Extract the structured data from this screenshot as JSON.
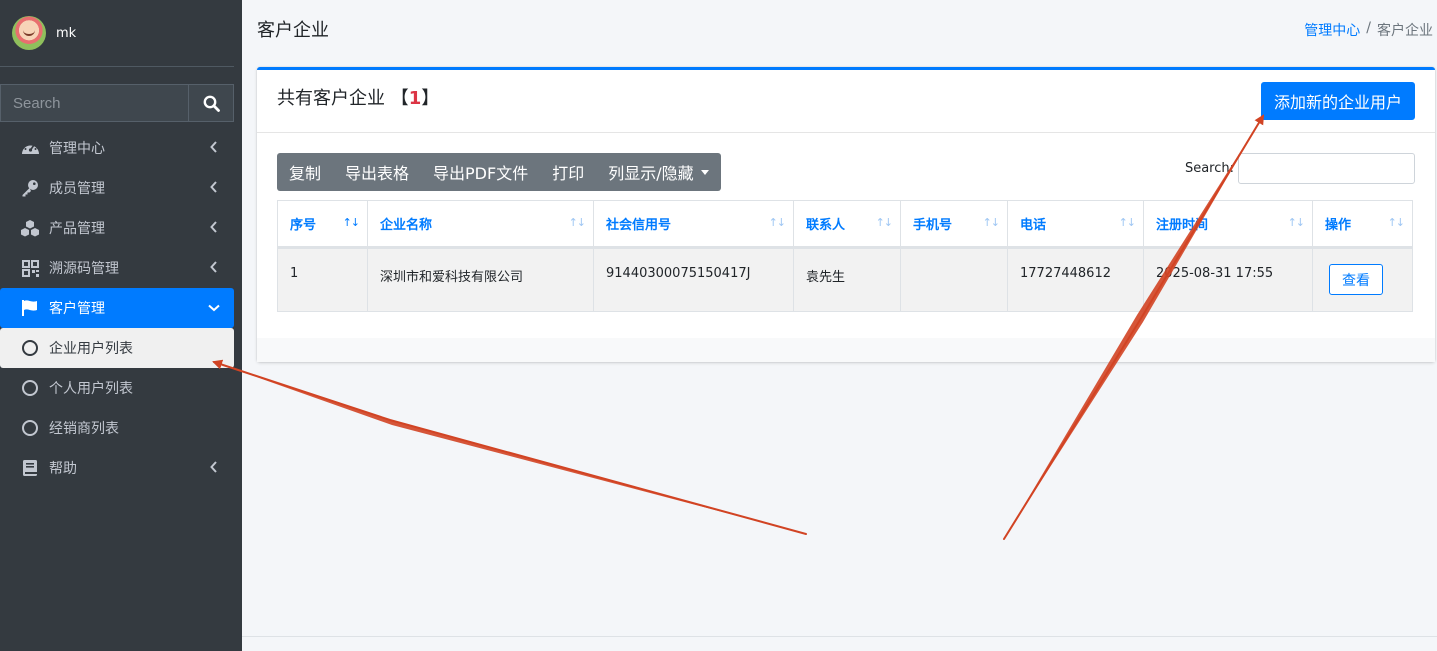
{
  "user": {
    "name": "mk"
  },
  "sidebar": {
    "search_placeholder": "Search",
    "items": [
      {
        "label": "管理中心",
        "icon": "dashboard-icon"
      },
      {
        "label": "成员管理",
        "icon": "key-icon"
      },
      {
        "label": "产品管理",
        "icon": "cubes-icon"
      },
      {
        "label": "溯源码管理",
        "icon": "qrcode-icon"
      },
      {
        "label": "客户管理",
        "icon": "flag-icon"
      }
    ],
    "subitems": [
      {
        "label": "企业用户列表"
      },
      {
        "label": "个人用户列表"
      },
      {
        "label": "经销商列表"
      }
    ],
    "help": {
      "label": "帮助",
      "icon": "book-icon"
    }
  },
  "header": {
    "title": "客户企业",
    "breadcrumb": {
      "home": "管理中心",
      "separator": "/",
      "current": "客户企业"
    }
  },
  "card": {
    "title_prefix": "共有客户企业 【",
    "count": "1",
    "title_suffix": "】",
    "add_button": "添加新的企业用户",
    "toolbar": [
      "复制",
      "导出表格",
      "导出PDF文件",
      "打印",
      "列显示/隐藏"
    ],
    "search_label": "Search:",
    "sort_icon": "↑↓"
  },
  "table": {
    "columns": [
      "序号",
      "企业名称",
      "社会信用号",
      "联系人",
      "手机号",
      "电话",
      "注册时间",
      "操作"
    ],
    "rows": [
      {
        "no": "1",
        "name": "深圳市和爱科技有限公司",
        "credit": "91440300075150417J",
        "contact": "袁先生",
        "mobile": "",
        "phone": "17727448612",
        "time": "2025-08-31 17:55",
        "action": "查看"
      }
    ]
  },
  "colors": {
    "accent": "#007bff",
    "sidebar": "#343a40",
    "annotation": "#d14424"
  }
}
